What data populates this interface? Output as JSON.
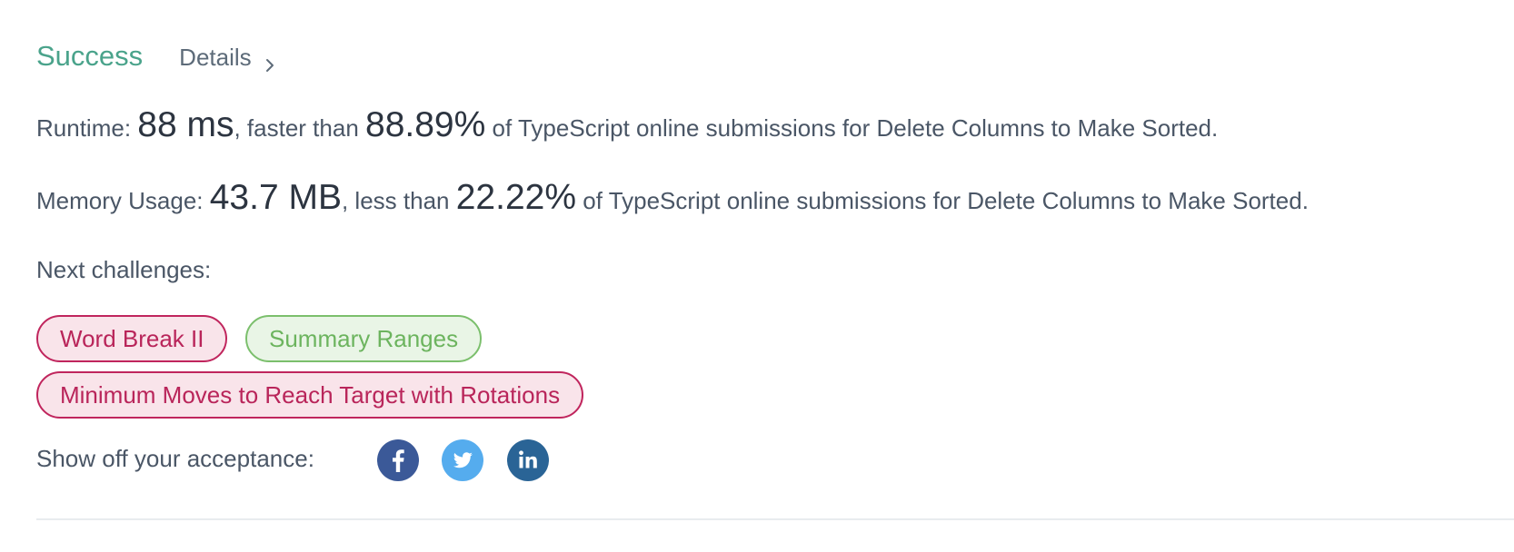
{
  "result": {
    "status": "Success",
    "details_label": "Details"
  },
  "runtime": {
    "label": "Runtime:",
    "value": "88 ms",
    "comparison": ", faster than",
    "percent": "88.89%",
    "suffix": "of TypeScript online submissions for Delete Columns to Make Sorted."
  },
  "memory": {
    "label": "Memory Usage:",
    "value": "43.7 MB",
    "comparison": ", less than",
    "percent": "22.22%",
    "suffix": "of TypeScript online submissions for Delete Columns to Make Sorted."
  },
  "next_challenges": {
    "label": "Next challenges:",
    "items": [
      {
        "title": "Word Break II",
        "difficulty": "hard"
      },
      {
        "title": "Summary Ranges",
        "difficulty": "easy"
      },
      {
        "title": "Minimum Moves to Reach Target with Rotations",
        "difficulty": "hard"
      }
    ]
  },
  "share": {
    "label": "Show off your acceptance:",
    "networks": [
      {
        "icon": "facebook-icon",
        "color": "#3b5998"
      },
      {
        "icon": "twitter-icon",
        "color": "#55acee"
      },
      {
        "icon": "linkedin-icon",
        "color": "#2a6496"
      }
    ]
  },
  "colors": {
    "success": "#4aa38b",
    "hard_border": "#c0255d",
    "hard_bg": "#f9e4ea",
    "easy_border": "#7bbf6c",
    "easy_bg": "#e9f5e6"
  }
}
